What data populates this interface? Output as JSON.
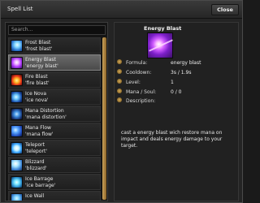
{
  "window": {
    "title": "Spell List",
    "close_label": "Close"
  },
  "search": {
    "placeholder": "Search..."
  },
  "spells": [
    {
      "name": "Frost Blast",
      "words": "'frost blast'",
      "icon": "icon-frost",
      "icon_name": "frost-blast-icon"
    },
    {
      "name": "Energy Blast",
      "words": "'energy blast'",
      "icon": "icon-energy",
      "icon_name": "energy-blast-icon",
      "selected": true
    },
    {
      "name": "Fire Blast",
      "words": "'fire blast'",
      "icon": "icon-fire",
      "icon_name": "fire-blast-icon"
    },
    {
      "name": "Ice Nova",
      "words": "'ice nova'",
      "icon": "icon-nova",
      "icon_name": "ice-nova-icon"
    },
    {
      "name": "Mana Distortion",
      "words": "'mana distortion'",
      "icon": "icon-distort",
      "icon_name": "mana-distortion-icon"
    },
    {
      "name": "Mana Flow",
      "words": "'mana flow'",
      "icon": "icon-flow",
      "icon_name": "mana-flow-icon"
    },
    {
      "name": "Teleport",
      "words": "'teleport'",
      "icon": "icon-teleport",
      "icon_name": "teleport-icon"
    },
    {
      "name": "Blizzard",
      "words": "'blizzard'",
      "icon": "icon-blizzard",
      "icon_name": "blizzard-icon"
    },
    {
      "name": "Ice Barrage",
      "words": "'ice barrage'",
      "icon": "icon-barrage",
      "icon_name": "ice-barrage-icon"
    },
    {
      "name": "Ice Wall",
      "words": "",
      "icon": "icon-wall",
      "icon_name": "ice-wall-icon"
    }
  ],
  "detail": {
    "name": "Energy Blast",
    "formula_label": "Formula:",
    "formula_value": "energy blast",
    "cooldown_label": "Cooldown:",
    "cooldown_value": "3s / 1.9s",
    "level_label": "Level:",
    "level_value": "1",
    "mana_label": "Mana / Soul:",
    "mana_value": "0 / 0",
    "description_label": "Description:",
    "description_text": "cast a energy blast wich restore mana on impact and deals energy damage to your target."
  },
  "colors": {
    "scroll_thumb": "#b8893e",
    "selected_item": "#5a5a5a"
  }
}
